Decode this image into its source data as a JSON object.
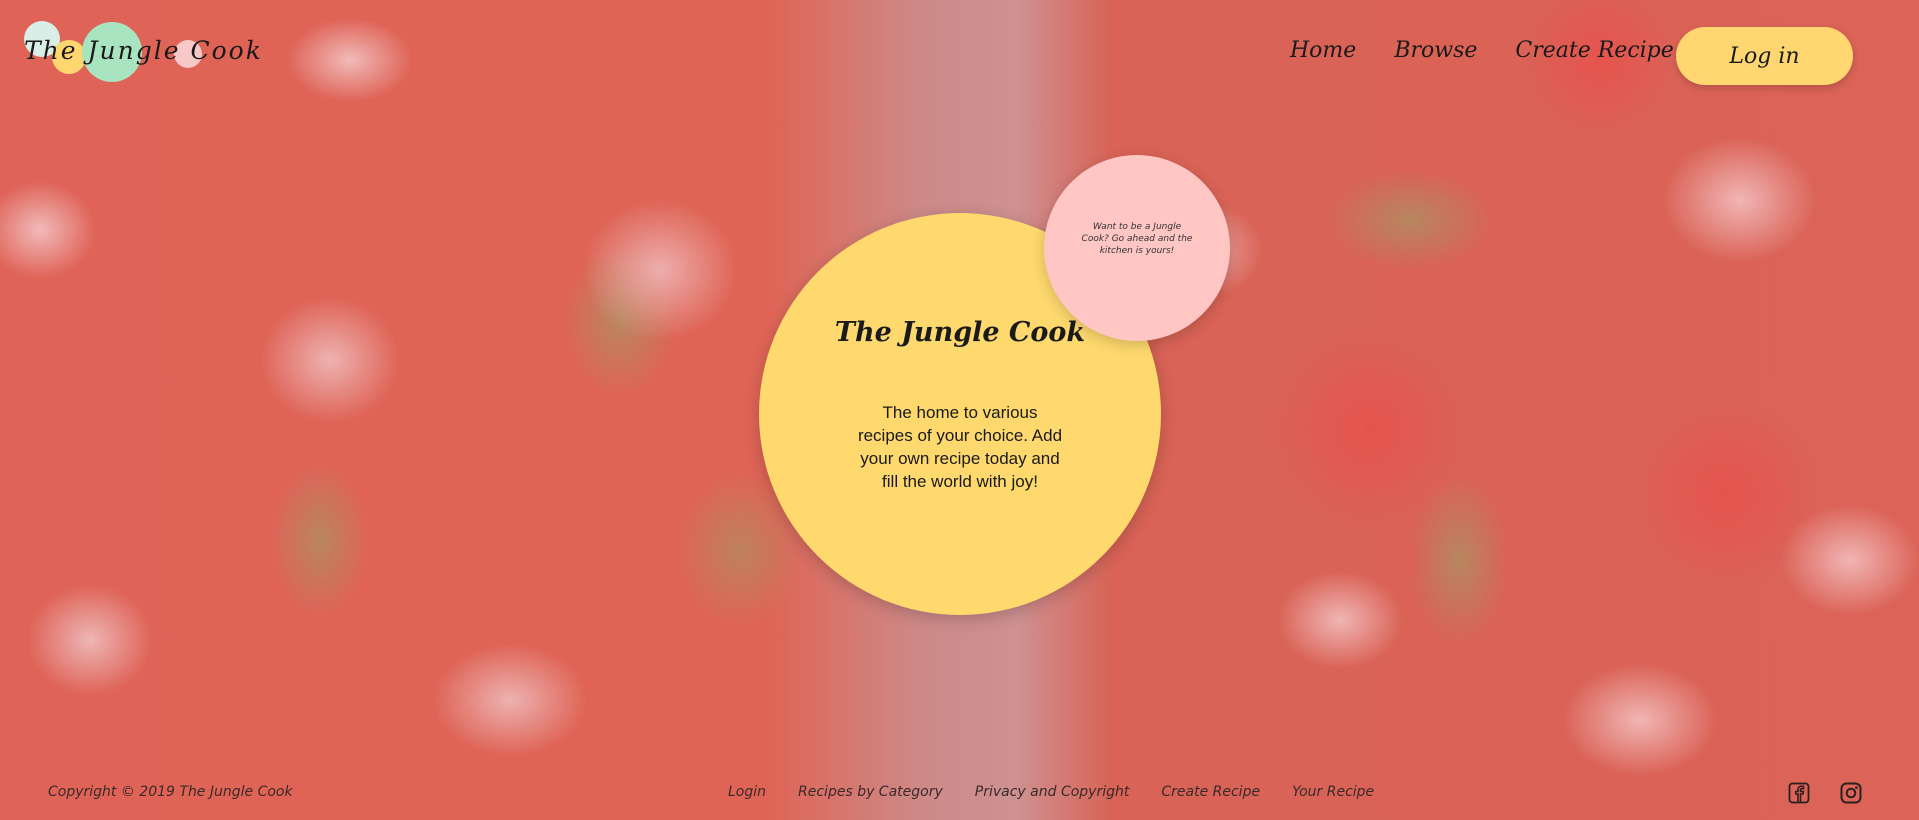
{
  "brand": {
    "logo_text": "The Jungle Cook",
    "colors": {
      "yellow": "#ffd670",
      "mint": "#a8e4c0",
      "pink": "#f8c8c8",
      "pale": "#d8eee6"
    }
  },
  "nav": {
    "items": [
      {
        "label": "Home"
      },
      {
        "label": "Browse"
      },
      {
        "label": "Create Recipe"
      }
    ],
    "login_label": "Log in"
  },
  "hero": {
    "title": "The Jungle Cook",
    "text": "The home to various recipes of your choice. Add your own recipe today and fill the world with joy!",
    "bubble_text": "Want to be a Jungle Cook? Go ahead and the kitchen is yours!"
  },
  "footer": {
    "copyright": "Copyright © 2019 The Jungle Cook",
    "links": [
      {
        "label": "Login"
      },
      {
        "label": "Recipes by Category"
      },
      {
        "label": "Privacy and Copyright"
      },
      {
        "label": "Create Recipe"
      },
      {
        "label": "Your Recipe"
      }
    ],
    "social_icons": [
      "facebook-icon",
      "instagram-icon"
    ]
  }
}
